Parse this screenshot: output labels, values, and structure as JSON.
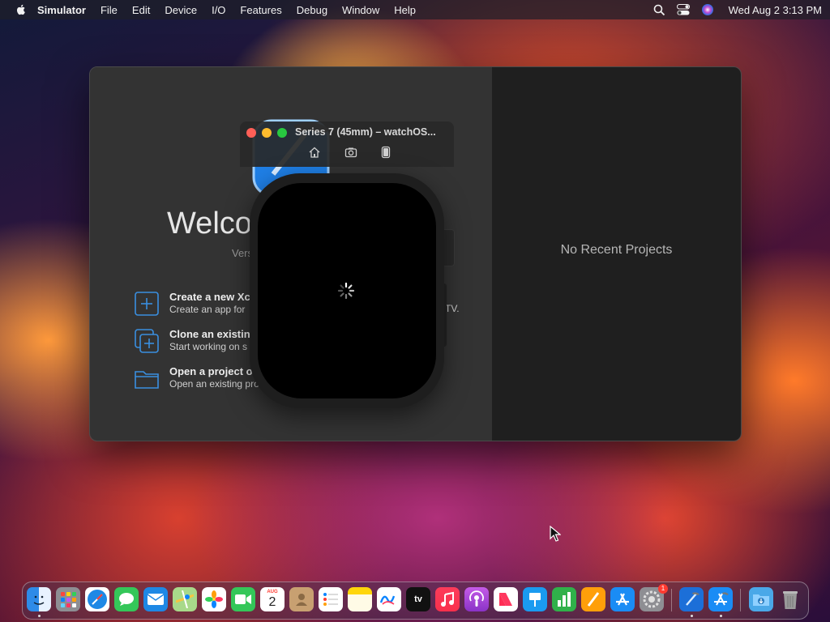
{
  "menubar": {
    "app_name": "Simulator",
    "menus": [
      "File",
      "Edit",
      "Device",
      "I/O",
      "Features",
      "Debug",
      "Window",
      "Help"
    ],
    "clock": "Wed Aug 2  3:13 PM"
  },
  "xcode_welcome": {
    "welcome_partial": "Welco",
    "version_partial": "Vers",
    "actions": [
      {
        "title": "Create a new Xc",
        "subtitle": "Create an app for",
        "icon": "plus-square-icon"
      },
      {
        "title": "Clone an existin",
        "subtitle": "Start working on s",
        "icon": "clone-plus-icon"
      },
      {
        "title": "Open a project o",
        "subtitle": "Open an existing pro",
        "icon": "folder-icon"
      }
    ],
    "subtitle_tail": "TV.",
    "no_recent": "No Recent Projects"
  },
  "simulator": {
    "title": "Series 7 (45mm) – watchOS...",
    "tools": [
      "home-icon",
      "screenshot-icon",
      "rotate-icon"
    ]
  },
  "dock": {
    "apps": [
      "Finder",
      "Launchpad",
      "Safari",
      "Messages",
      "Mail",
      "Maps",
      "Photos",
      "FaceTime",
      "Calendar",
      "Contacts",
      "Reminders",
      "Notes",
      "Freeform",
      "TV",
      "Music",
      "Podcasts",
      "News",
      "Keynote",
      "Numbers",
      "Pages",
      "App Store",
      "System Settings",
      "Xcode",
      "Simulator",
      "Downloads",
      "Trash"
    ],
    "calendar_month": "AUG",
    "calendar_day": "2",
    "tv_label": "tv",
    "settings_badge": "1"
  },
  "colors": {
    "accent_blue": "#3a8fe0",
    "traffic_red": "#ff5f57",
    "traffic_yellow": "#febc2e",
    "traffic_green": "#28c840"
  }
}
